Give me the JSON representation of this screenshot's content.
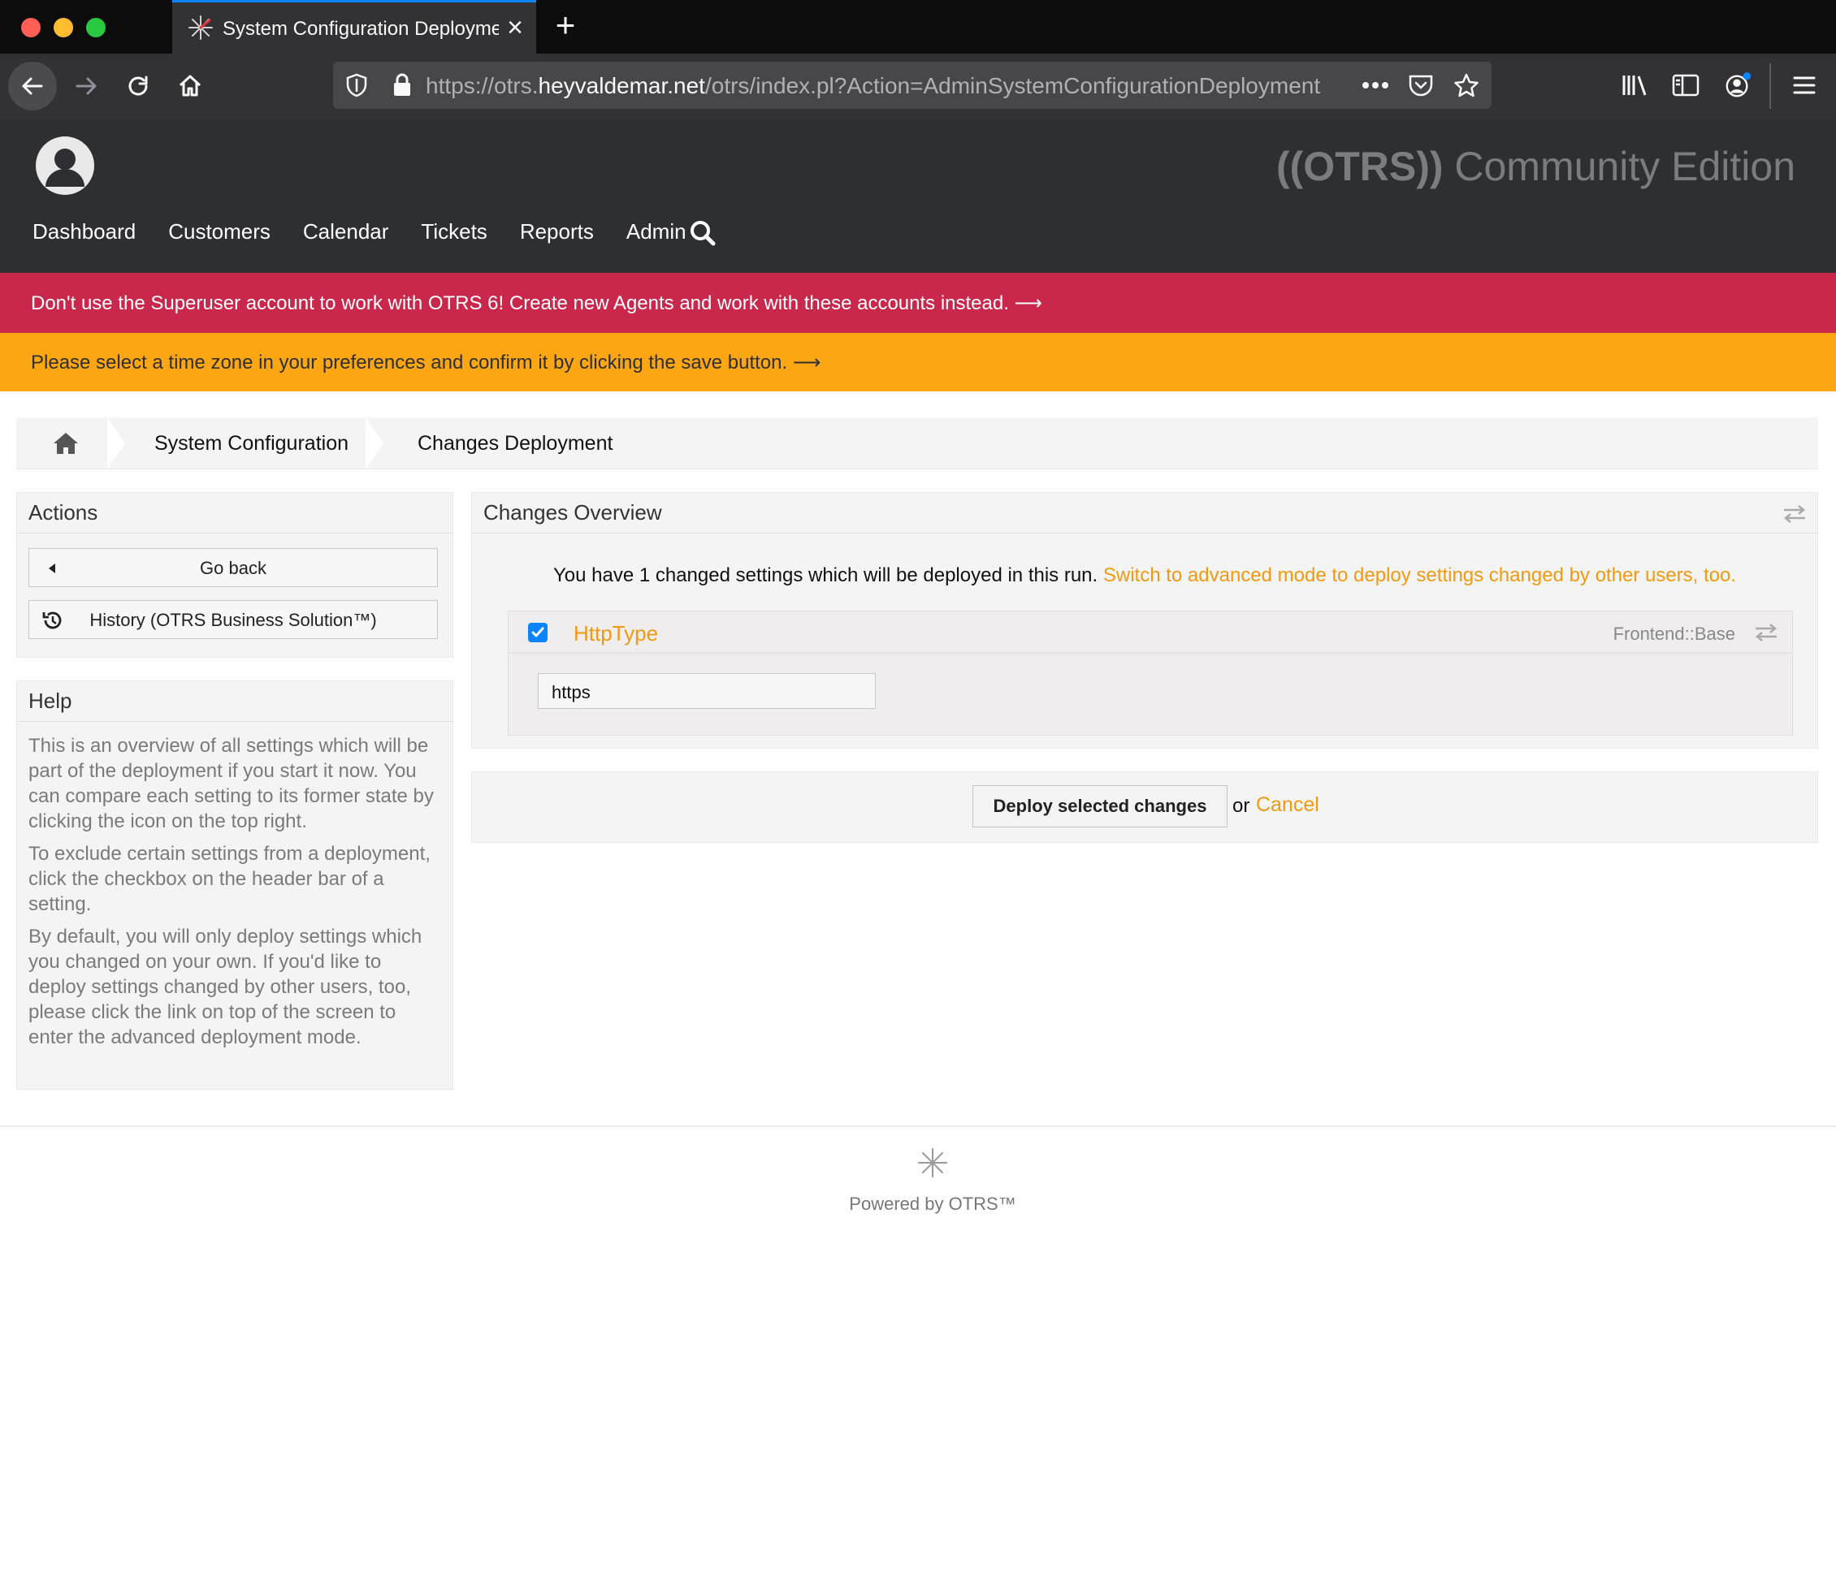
{
  "browser": {
    "tab_title": "System Configuration Deployment",
    "url_prefix": "https://otrs.",
    "url_host": "heyvaldemar.net",
    "url_path": "/otrs/index.pl?Action=AdminSystemConfigurationDeployment",
    "accent_color": "#0a84ff"
  },
  "header": {
    "brand_bold": "((OTRS))",
    "brand_rest": " Community Edition",
    "nav": [
      "Dashboard",
      "Customers",
      "Calendar",
      "Tickets",
      "Reports",
      "Admin"
    ]
  },
  "notices": {
    "superuser": "Don't use the Superuser account to work with OTRS 6! Create new Agents and work with these accounts instead. ⟶",
    "timezone": "Please select a time zone in your preferences and confirm it by clicking the save button. ⟶",
    "superuser_color": "#c9274b",
    "timezone_color": "#fda614"
  },
  "breadcrumb": {
    "items": [
      "System Configuration",
      "Changes Deployment"
    ]
  },
  "actions": {
    "title": "Actions",
    "go_back": "Go back",
    "history": "History (OTRS Business Solution™)"
  },
  "help": {
    "title": "Help",
    "paragraphs": [
      "This is an overview of all settings which will be part of the deployment if you start it now. You can compare each setting to its former state by clicking the icon on the top right.",
      "To exclude certain settings from a deployment, click the checkbox on the header bar of a setting.",
      "By default, you will only deploy settings which you changed on your own. If you'd like to deploy settings changed by other users, too, please click the link on top of the screen to enter the advanced deployment mode."
    ]
  },
  "overview": {
    "title": "Changes Overview",
    "message": "You have 1 changed settings which will be deployed in this run. ",
    "advanced_link": "Switch to advanced mode to deploy settings changed by other users, too.",
    "setting": {
      "name": "HttpType",
      "namespace": "Frontend::Base",
      "value": "https",
      "checked": true
    }
  },
  "deploy": {
    "button": "Deploy selected changes",
    "or": "or",
    "cancel": "Cancel"
  },
  "footer": {
    "text": "Powered by OTRS™"
  },
  "colors": {
    "link_orange": "#f29911",
    "header_dark": "#2e2f33"
  }
}
